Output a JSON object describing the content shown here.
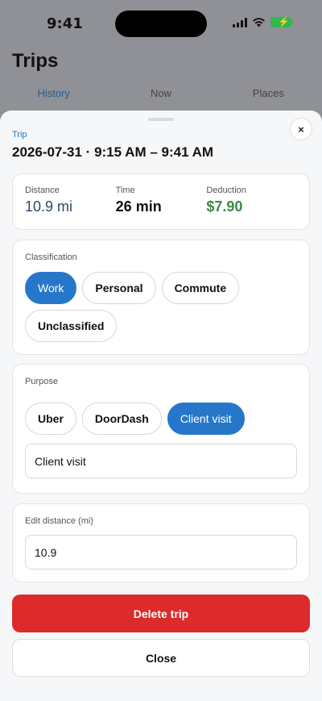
{
  "status_bar": {
    "time": "9:41"
  },
  "screen": {
    "title": "Trips",
    "tabs": [
      {
        "label": "History",
        "active": true
      },
      {
        "label": "Now",
        "active": false
      },
      {
        "label": "Places",
        "active": false
      }
    ]
  },
  "sheet": {
    "label": "Trip",
    "title": "2026-07-31 · 9:15 AM – 9:41 AM",
    "close_icon": "×",
    "stats": [
      {
        "label": "Distance",
        "value": "10.9 mi"
      },
      {
        "label": "Time",
        "value": "26 min"
      },
      {
        "label": "Deduction",
        "value": "$7.90"
      }
    ],
    "classification": {
      "label": "Classification",
      "options": [
        "Work",
        "Personal",
        "Commute",
        "Unclassified"
      ],
      "selected": "Work"
    },
    "purpose": {
      "label": "Purpose",
      "options": [
        "Uber",
        "DoorDash",
        "Client visit"
      ],
      "selected": "Client visit",
      "input_value": "Client visit"
    },
    "edit_distance": {
      "label": "Edit distance (mi)",
      "input_value": "10.9"
    },
    "delete_label": "Delete trip",
    "close_label": "Close"
  },
  "colors": {
    "accent": "#2677c9",
    "danger": "#dd2a2a",
    "money": "#3a8a44"
  }
}
